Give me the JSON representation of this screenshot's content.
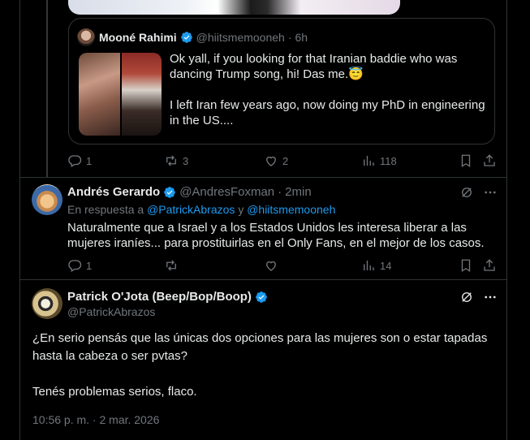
{
  "quoted_tweet": {
    "author_name": "Mooné Rahimi",
    "author_handle": "@hiitsmemooneh",
    "time": "6h",
    "text": "Ok yall, if you looking for that Iranian baddie who was dancing Trump song, hi! Das me.😇\n\nI left Iran few years ago, now doing my PhD in engineering in the US...."
  },
  "parent_actions": {
    "replies": "1",
    "retweets": "3",
    "likes": "2",
    "views": "118"
  },
  "reply": {
    "author_name": "Andrés Gerardo",
    "author_handle": "@AndresFoxman",
    "separator": "·",
    "time": "2min",
    "reply_prefix": "En respuesta a",
    "reply_user1": "@PatrickAbrazos",
    "reply_conj": "y",
    "reply_user2": "@hiitsmemooneh",
    "text": "Naturalmente que a Israel y a los Estados Unidos les interesa liberar a las mujeres iraníes... para prostituirlas en el Only Fans, en el mejor de los casos.",
    "replies": "1",
    "views": "14"
  },
  "main_tweet": {
    "author_name": "Patrick O'Jota (Beep/Bop/Boop)",
    "author_handle": "@PatrickAbrazos",
    "text": "¿En serio pensás que las únicas dos opciones para las mujeres son o estar tapadas hasta la cabeza o ser pvtas?\n\nTenés problemas serios, flaco.",
    "timestamp": "10:56 p. m. · 2 mar. 2026"
  },
  "colors": {
    "background": "#000000",
    "text": "#e7e9ea",
    "muted": "#71767b",
    "link": "#1d9bf0",
    "border": "#2f3336",
    "verified": "#1d9bf0"
  }
}
